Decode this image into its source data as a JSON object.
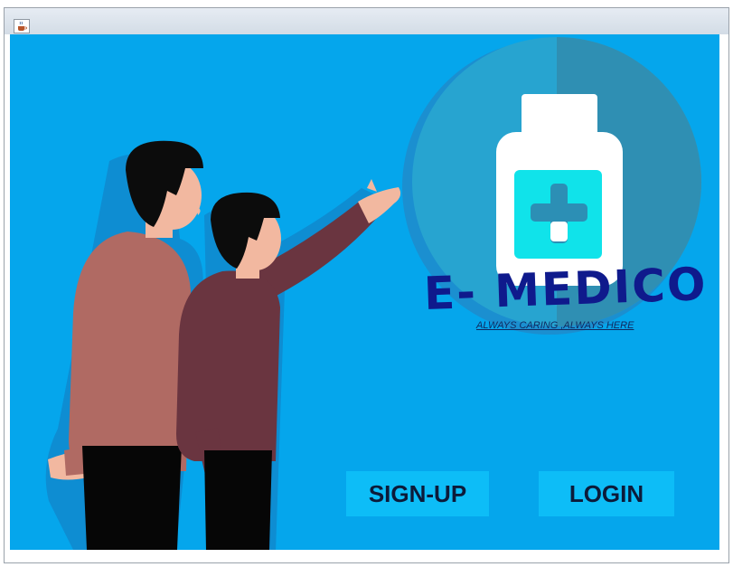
{
  "window": {
    "icon": "java-coffee-icon"
  },
  "brand": {
    "title": "E- MEDICO",
    "tagline": "ALWAYS CARING ,ALWAYS HERE",
    "logo_icon": "medicine-bottle-icon"
  },
  "actions": {
    "signup_label": "SIGN-UP",
    "login_label": "LOGIN"
  },
  "colors": {
    "background": "#05a6ec",
    "button": "#0dbdf7",
    "brand_text": "#0f1a8c",
    "bottle_label": "#10e3ea"
  }
}
